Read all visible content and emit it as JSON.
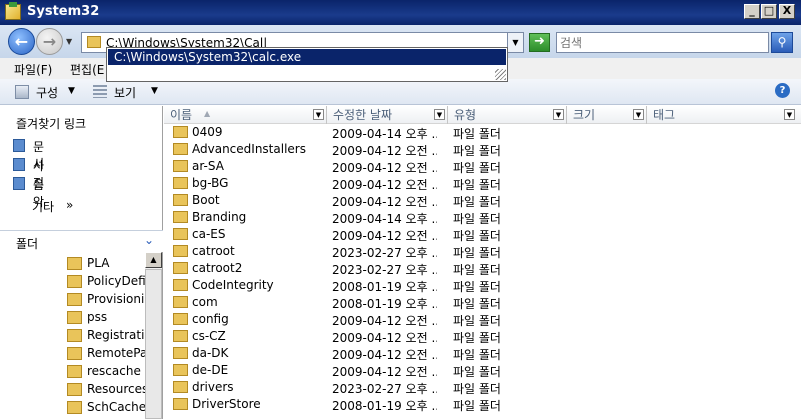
{
  "window": {
    "title": "System32",
    "minimize": "_",
    "maximize": "□",
    "close": "X"
  },
  "nav": {
    "back_icon": "back-arrow-icon",
    "forward_icon": "forward-arrow-icon"
  },
  "address": {
    "value": "C:\\Windows\\System32\\Cal|",
    "go_icon": "go-arrow-icon"
  },
  "autocomplete": {
    "items": [
      "C:\\Windows\\System32\\calc.exe"
    ]
  },
  "search": {
    "placeholder": "검색"
  },
  "menu": {
    "file": "파일(F)",
    "edit": "편집(E"
  },
  "toolbar": {
    "organize": "구성",
    "views": "보기"
  },
  "favorites": {
    "heading": "즐겨찾기 링크",
    "items": [
      {
        "label": "문서"
      },
      {
        "label": "사진"
      },
      {
        "label": "음악"
      }
    ],
    "more": "기타",
    "more_glyph": "»"
  },
  "folders": {
    "heading": "폴더",
    "items": [
      "PLA",
      "PolicyDefini",
      "Provisionin",
      "pss",
      "Registration",
      "RemotePa",
      "rescache",
      "Resources",
      "SchCache"
    ]
  },
  "columns": {
    "name": "이름",
    "modified": "수정한 날짜",
    "type": "유형",
    "size": "크기",
    "tag": "태그"
  },
  "files": [
    {
      "name": "0409",
      "modified": "2009-04-14 오후 ...",
      "type": "파일 폴더"
    },
    {
      "name": "AdvancedInstallers",
      "modified": "2009-04-12 오전 ...",
      "type": "파일 폴더"
    },
    {
      "name": "ar-SA",
      "modified": "2009-04-12 오전 ...",
      "type": "파일 폴더"
    },
    {
      "name": "bg-BG",
      "modified": "2009-04-12 오전 ...",
      "type": "파일 폴더"
    },
    {
      "name": "Boot",
      "modified": "2009-04-12 오전 ...",
      "type": "파일 폴더"
    },
    {
      "name": "Branding",
      "modified": "2009-04-14 오후 ...",
      "type": "파일 폴더"
    },
    {
      "name": "ca-ES",
      "modified": "2009-04-12 오전 ...",
      "type": "파일 폴더"
    },
    {
      "name": "catroot",
      "modified": "2023-02-27 오후 ...",
      "type": "파일 폴더"
    },
    {
      "name": "catroot2",
      "modified": "2023-02-27 오후 ...",
      "type": "파일 폴더"
    },
    {
      "name": "CodeIntegrity",
      "modified": "2008-01-19 오후 ...",
      "type": "파일 폴더"
    },
    {
      "name": "com",
      "modified": "2008-01-19 오후 ...",
      "type": "파일 폴더"
    },
    {
      "name": "config",
      "modified": "2009-04-12 오전 ...",
      "type": "파일 폴더"
    },
    {
      "name": "cs-CZ",
      "modified": "2009-04-12 오전 ...",
      "type": "파일 폴더"
    },
    {
      "name": "da-DK",
      "modified": "2009-04-12 오전 ...",
      "type": "파일 폴더"
    },
    {
      "name": "de-DE",
      "modified": "2009-04-12 오전 ...",
      "type": "파일 폴더"
    },
    {
      "name": "drivers",
      "modified": "2023-02-27 오후 ...",
      "type": "파일 폴더"
    },
    {
      "name": "DriverStore",
      "modified": "2008-01-19 오후 ...",
      "type": "파일 폴더"
    }
  ]
}
